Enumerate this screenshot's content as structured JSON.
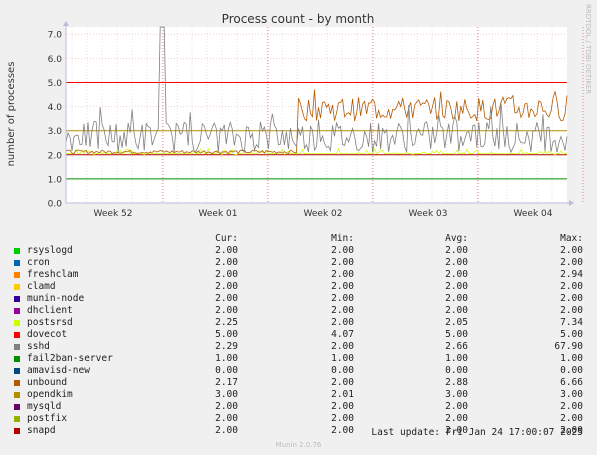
{
  "header": {
    "title": "Process count - by month",
    "watermark": "RRDTOOL / TOBI OETIKER"
  },
  "chart_data": {
    "type": "line",
    "title": "Process count - by month",
    "ylabel": "number of processes",
    "xlabel": "",
    "ylim": [
      0,
      7.3
    ],
    "y_ticks": [
      0.0,
      1.0,
      2.0,
      3.0,
      4.0,
      5.0,
      6.0,
      7.0
    ],
    "y_tick_labels": [
      "0.0",
      "1.0",
      "2.0",
      "3.0",
      "4.0",
      "5.0",
      "6.0",
      "7.0"
    ],
    "x_tick_labels": [
      "Week 52",
      "Week 01",
      "Week 02",
      "Week 03",
      "Week 04"
    ],
    "grid": true,
    "series": [
      {
        "name": "rsyslogd",
        "color": "#00cc00",
        "cur": 2.0,
        "min": 2.0,
        "avg": 2.0,
        "max": 2.0
      },
      {
        "name": "cron",
        "color": "#0066b3",
        "cur": 2.0,
        "min": 2.0,
        "avg": 2.0,
        "max": 2.0
      },
      {
        "name": "freshclam",
        "color": "#ff8000",
        "cur": 2.0,
        "min": 2.0,
        "avg": 2.0,
        "max": 2.94
      },
      {
        "name": "clamd",
        "color": "#ffcc00",
        "cur": 2.0,
        "min": 2.0,
        "avg": 2.0,
        "max": 2.0
      },
      {
        "name": "munin-node",
        "color": "#330099",
        "cur": 2.0,
        "min": 2.0,
        "avg": 2.0,
        "max": 2.0
      },
      {
        "name": "dhclient",
        "color": "#990099",
        "cur": 2.0,
        "min": 2.0,
        "avg": 2.0,
        "max": 2.0
      },
      {
        "name": "postsrsd",
        "color": "#ccff00",
        "cur": 2.25,
        "min": 2.0,
        "avg": 2.05,
        "max": 7.34
      },
      {
        "name": "dovecot",
        "color": "#ff0000",
        "cur": 5.0,
        "min": 4.07,
        "avg": 5.0,
        "max": 5.0
      },
      {
        "name": "sshd",
        "color": "#808080",
        "cur": 2.29,
        "min": 2.0,
        "avg": 2.66,
        "max": 67.9
      },
      {
        "name": "fail2ban-server",
        "color": "#008f00",
        "cur": 1.0,
        "min": 1.0,
        "avg": 1.0,
        "max": 1.0
      },
      {
        "name": "amavisd-new",
        "color": "#00487d",
        "cur": 0.0,
        "min": 0.0,
        "avg": 0.0,
        "max": 0.0
      },
      {
        "name": "unbound",
        "color": "#b35a00",
        "cur": 2.17,
        "min": 2.0,
        "avg": 2.88,
        "max": 6.66
      },
      {
        "name": "opendkim",
        "color": "#b38f00",
        "cur": 3.0,
        "min": 2.01,
        "avg": 3.0,
        "max": 3.0
      },
      {
        "name": "mysqld",
        "color": "#6b006b",
        "cur": 2.0,
        "min": 2.0,
        "avg": 2.0,
        "max": 2.0
      },
      {
        "name": "postfix",
        "color": "#8fb300",
        "cur": 2.0,
        "min": 2.0,
        "avg": 2.0,
        "max": 2.0
      },
      {
        "name": "snapd",
        "color": "#b30000",
        "cur": 2.0,
        "min": 2.0,
        "avg": 2.0,
        "max": 2.0
      }
    ]
  },
  "legend": {
    "col_cur": "Cur:",
    "col_min": "Min:",
    "col_avg": "Avg:",
    "col_max": "Max:",
    "rows": [
      {
        "name": "rsyslogd",
        "cur": "2.00",
        "min": "2.00",
        "avg": "2.00",
        "max": "2.00"
      },
      {
        "name": "cron",
        "cur": "2.00",
        "min": "2.00",
        "avg": "2.00",
        "max": "2.00"
      },
      {
        "name": "freshclam",
        "cur": "2.00",
        "min": "2.00",
        "avg": "2.00",
        "max": "2.94"
      },
      {
        "name": "clamd",
        "cur": "2.00",
        "min": "2.00",
        "avg": "2.00",
        "max": "2.00"
      },
      {
        "name": "munin-node",
        "cur": "2.00",
        "min": "2.00",
        "avg": "2.00",
        "max": "2.00"
      },
      {
        "name": "dhclient",
        "cur": "2.00",
        "min": "2.00",
        "avg": "2.00",
        "max": "2.00"
      },
      {
        "name": "postsrsd",
        "cur": "2.25",
        "min": "2.00",
        "avg": "2.05",
        "max": "7.34"
      },
      {
        "name": "dovecot",
        "cur": "5.00",
        "min": "4.07",
        "avg": "5.00",
        "max": "5.00"
      },
      {
        "name": "sshd",
        "cur": "2.29",
        "min": "2.00",
        "avg": "2.66",
        "max": "67.90"
      },
      {
        "name": "fail2ban-server",
        "cur": "1.00",
        "min": "1.00",
        "avg": "1.00",
        "max": "1.00"
      },
      {
        "name": "amavisd-new",
        "cur": "0.00",
        "min": "0.00",
        "avg": "0.00",
        "max": "0.00"
      },
      {
        "name": "unbound",
        "cur": "2.17",
        "min": "2.00",
        "avg": "2.88",
        "max": "6.66"
      },
      {
        "name": "opendkim",
        "cur": "3.00",
        "min": "2.01",
        "avg": "3.00",
        "max": "3.00"
      },
      {
        "name": "mysqld",
        "cur": "2.00",
        "min": "2.00",
        "avg": "2.00",
        "max": "2.00"
      },
      {
        "name": "postfix",
        "cur": "2.00",
        "min": "2.00",
        "avg": "2.00",
        "max": "2.00"
      },
      {
        "name": "snapd",
        "cur": "2.00",
        "min": "2.00",
        "avg": "2.00",
        "max": "2.00"
      }
    ]
  },
  "footer": {
    "last_update": "Last update: Fri Jan 24 17:00:07 2025",
    "version": "Munin 2.0.76"
  }
}
